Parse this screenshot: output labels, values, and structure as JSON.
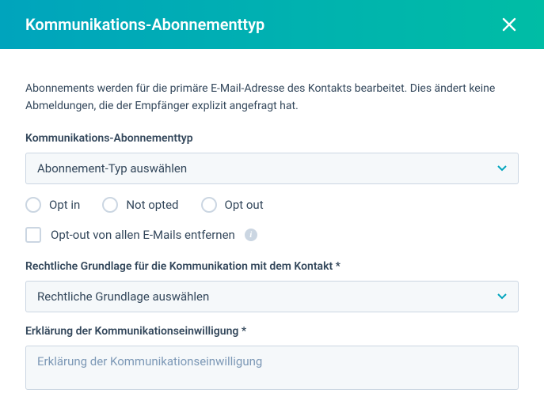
{
  "header": {
    "title": "Kommunikations-Abonnementtyp"
  },
  "description": "Abonnements werden für die primäre E-Mail-Adresse des Kontakts bearbeitet. Dies ändert keine Abmeldungen, die der Empfänger explizit angefragt hat.",
  "subscriptionType": {
    "label": "Kommunikations-Abonnementtyp",
    "placeholder": "Abonnement-Typ auswählen"
  },
  "optStatus": {
    "options": [
      "Opt in",
      "Not opted",
      "Opt out"
    ]
  },
  "removeOptOut": {
    "label": "Opt-out von allen E-Mails entfernen"
  },
  "legalBasis": {
    "label": "Rechtliche Grundlage für die Kommunikation mit dem Kontakt",
    "placeholder": "Rechtliche Grundlage auswählen"
  },
  "consentExplanation": {
    "label": "Erklärung der Kommunikationseinwilligung",
    "placeholder": "Erklärung der Kommunikationseinwilligung"
  },
  "icons": {
    "info": "i"
  },
  "colors": {
    "headerGradientStart": "#00a4bd",
    "headerGradientEnd": "#00bda5",
    "border": "#cbd6e2",
    "text": "#33475b",
    "accent": "#00a4bd"
  }
}
